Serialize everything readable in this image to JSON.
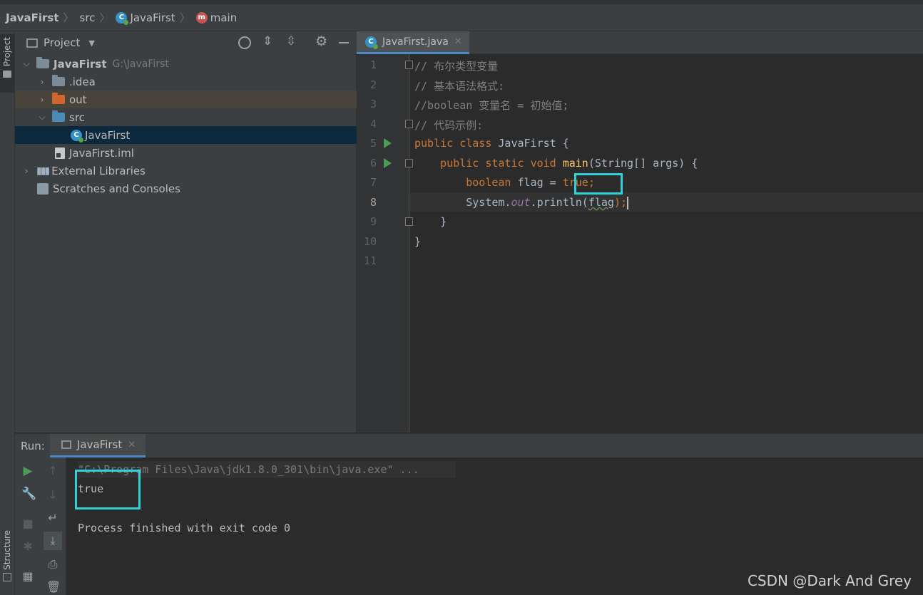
{
  "breadcrumb": {
    "items": [
      "JavaFirst",
      "src",
      "JavaFirst",
      "main"
    ]
  },
  "left_strip": {
    "project_label": "Project",
    "structure_label": "Structure"
  },
  "project_panel": {
    "title": "Project",
    "tree": [
      {
        "label": "JavaFirst",
        "path": "G:\\JavaFirst",
        "level": 0,
        "expanded": true,
        "type": "module"
      },
      {
        "label": ".idea",
        "level": 1,
        "expanded": false,
        "type": "folder"
      },
      {
        "label": "out",
        "level": 1,
        "expanded": false,
        "type": "folder-excluded"
      },
      {
        "label": "src",
        "level": 1,
        "expanded": true,
        "type": "folder-source"
      },
      {
        "label": "JavaFirst",
        "level": 2,
        "type": "class",
        "selected": true
      },
      {
        "label": "JavaFirst.iml",
        "level": 1,
        "type": "file"
      },
      {
        "label": "External Libraries",
        "level": 0,
        "expanded": false,
        "type": "libraries"
      },
      {
        "label": "Scratches and Consoles",
        "level": 0,
        "type": "scratches"
      }
    ]
  },
  "editor": {
    "tab_label": "JavaFirst.java",
    "current_line": 8,
    "line_numbers": [
      "1",
      "2",
      "3",
      "4",
      "5",
      "6",
      "7",
      "8",
      "9",
      "10",
      "11"
    ],
    "lines": [
      "// 布尔类型变量",
      "// 基本语法格式:",
      "//boolean 变量名 = 初始值;",
      "// 代码示例:",
      "public class JavaFirst {",
      "    public static void main(String[] args) {",
      "        boolean flag = true;",
      "        System.out.println(flag);",
      "    }",
      "}",
      ""
    ],
    "tokens": {
      "public": "public",
      "class": "class",
      "classname": "JavaFirst",
      "brace_open": " {",
      "static": "static",
      "void": "void",
      "main": "main",
      "main_args": "(String[] args) {",
      "boolean": "boolean",
      "flag_decl": "flag = ",
      "true": "true;",
      "system": "System.",
      "out": "out",
      "println": ".println(",
      "flag": "flag",
      "close": ");",
      "brace_close": "}"
    }
  },
  "run_panel": {
    "label": "Run:",
    "tab_label": "JavaFirst",
    "console_lines": [
      "\"C:\\Program Files\\Java\\jdk1.8.0_301\\bin\\java.exe\" ...",
      "true",
      "",
      "Process finished with exit code 0"
    ]
  },
  "watermark": "CSDN @Dark And Grey",
  "colors": {
    "keyword": "#cc7832",
    "function": "#ffc66d",
    "comment": "#808080",
    "highlight_box": "#2fd2d8",
    "selection": "#0d293e"
  }
}
